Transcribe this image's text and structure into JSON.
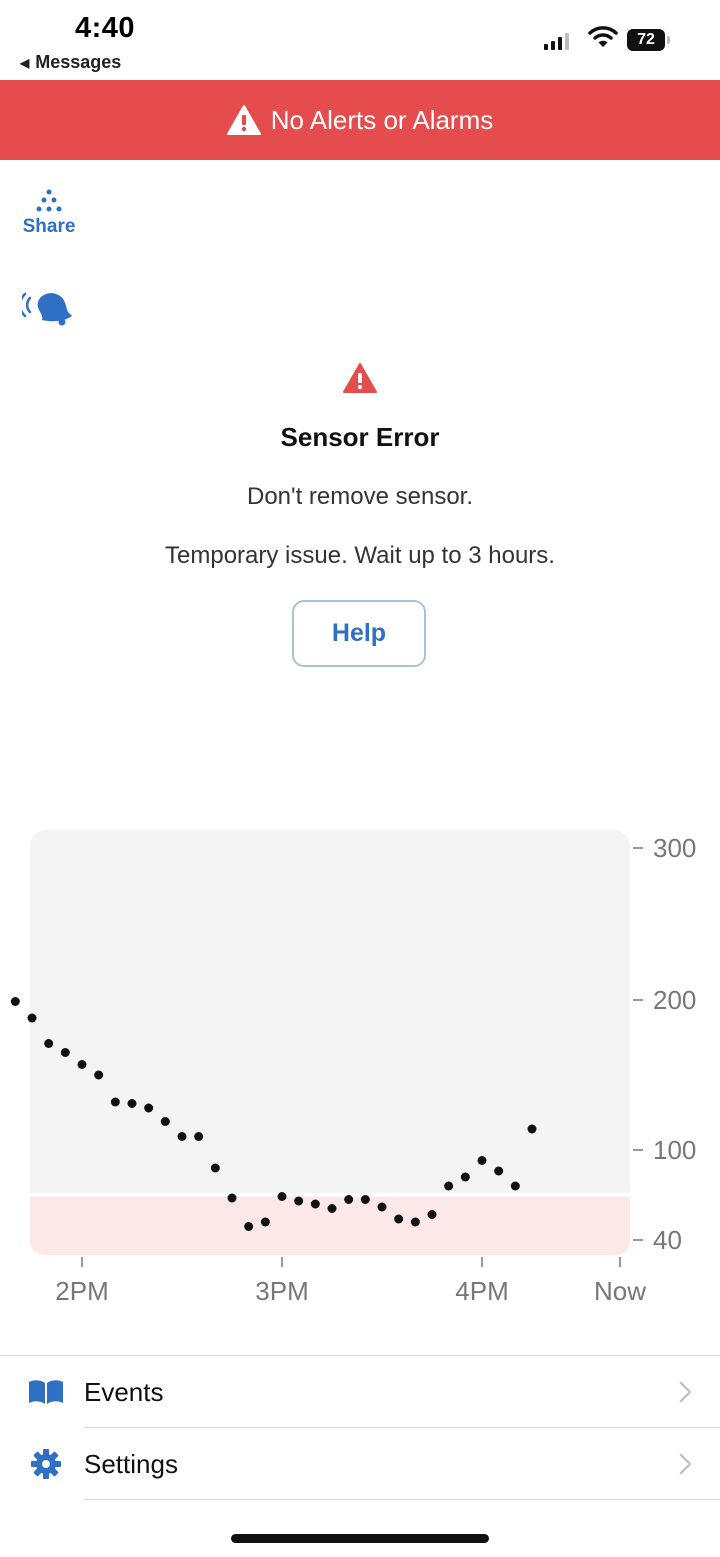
{
  "status_bar": {
    "time": "4:40",
    "back_label": "Messages",
    "battery": "72"
  },
  "banner": {
    "text": "No Alerts or Alarms",
    "icon": "warning-icon",
    "color": "#e44c4d"
  },
  "share": {
    "label": "Share",
    "icon": "share-dots-icon"
  },
  "alert_sound": {
    "icon": "ringing-bell-icon"
  },
  "sensor_error": {
    "icon": "warning-triangle-icon",
    "title": "Sensor Error",
    "line1": "Don't remove sensor.",
    "line2": "Temporary issue. Wait up to 3 hours.",
    "help_label": "Help"
  },
  "chart_data": {
    "type": "scatter",
    "title": "",
    "xlabel": "",
    "ylabel": "",
    "y_ticks": [
      "300",
      "200",
      "100",
      "40"
    ],
    "x_ticks": [
      "2PM",
      "3PM",
      "4PM",
      "Now"
    ],
    "target_low": 70,
    "ylim": [
      40,
      300
    ],
    "colors": {
      "point": "#111111",
      "background": "#f4f4f4",
      "low_band": "#fce8e8"
    },
    "points": [
      {
        "x": "1:40PM",
        "y": 199
      },
      {
        "x": "1:45PM",
        "y": 188
      },
      {
        "x": "1:50PM",
        "y": 171
      },
      {
        "x": "1:55PM",
        "y": 165
      },
      {
        "x": "2:00PM",
        "y": 157
      },
      {
        "x": "2:05PM",
        "y": 150
      },
      {
        "x": "2:10PM",
        "y": 132
      },
      {
        "x": "2:15PM",
        "y": 131
      },
      {
        "x": "2:20PM",
        "y": 128
      },
      {
        "x": "2:25PM",
        "y": 119
      },
      {
        "x": "2:30PM",
        "y": 109
      },
      {
        "x": "2:35PM",
        "y": 109
      },
      {
        "x": "2:40PM",
        "y": 88
      },
      {
        "x": "2:45PM",
        "y": 68
      },
      {
        "x": "2:50PM",
        "y": 49
      },
      {
        "x": "2:55PM",
        "y": 52
      },
      {
        "x": "3:00PM",
        "y": 69
      },
      {
        "x": "3:05PM",
        "y": 66
      },
      {
        "x": "3:10PM",
        "y": 64
      },
      {
        "x": "3:15PM",
        "y": 61
      },
      {
        "x": "3:20PM",
        "y": 67
      },
      {
        "x": "3:25PM",
        "y": 67
      },
      {
        "x": "3:30PM",
        "y": 62
      },
      {
        "x": "3:35PM",
        "y": 54
      },
      {
        "x": "3:40PM",
        "y": 52
      },
      {
        "x": "3:45PM",
        "y": 57
      },
      {
        "x": "3:50PM",
        "y": 76
      },
      {
        "x": "3:55PM",
        "y": 82
      },
      {
        "x": "4:00PM",
        "y": 93
      },
      {
        "x": "4:05PM",
        "y": 86
      },
      {
        "x": "4:10PM",
        "y": 76
      },
      {
        "x": "4:15PM",
        "y": 114
      }
    ]
  },
  "menu": [
    {
      "label": "Events",
      "icon": "book-icon"
    },
    {
      "label": "Settings",
      "icon": "gear-icon"
    }
  ],
  "accent_color": "#2f6fc4"
}
